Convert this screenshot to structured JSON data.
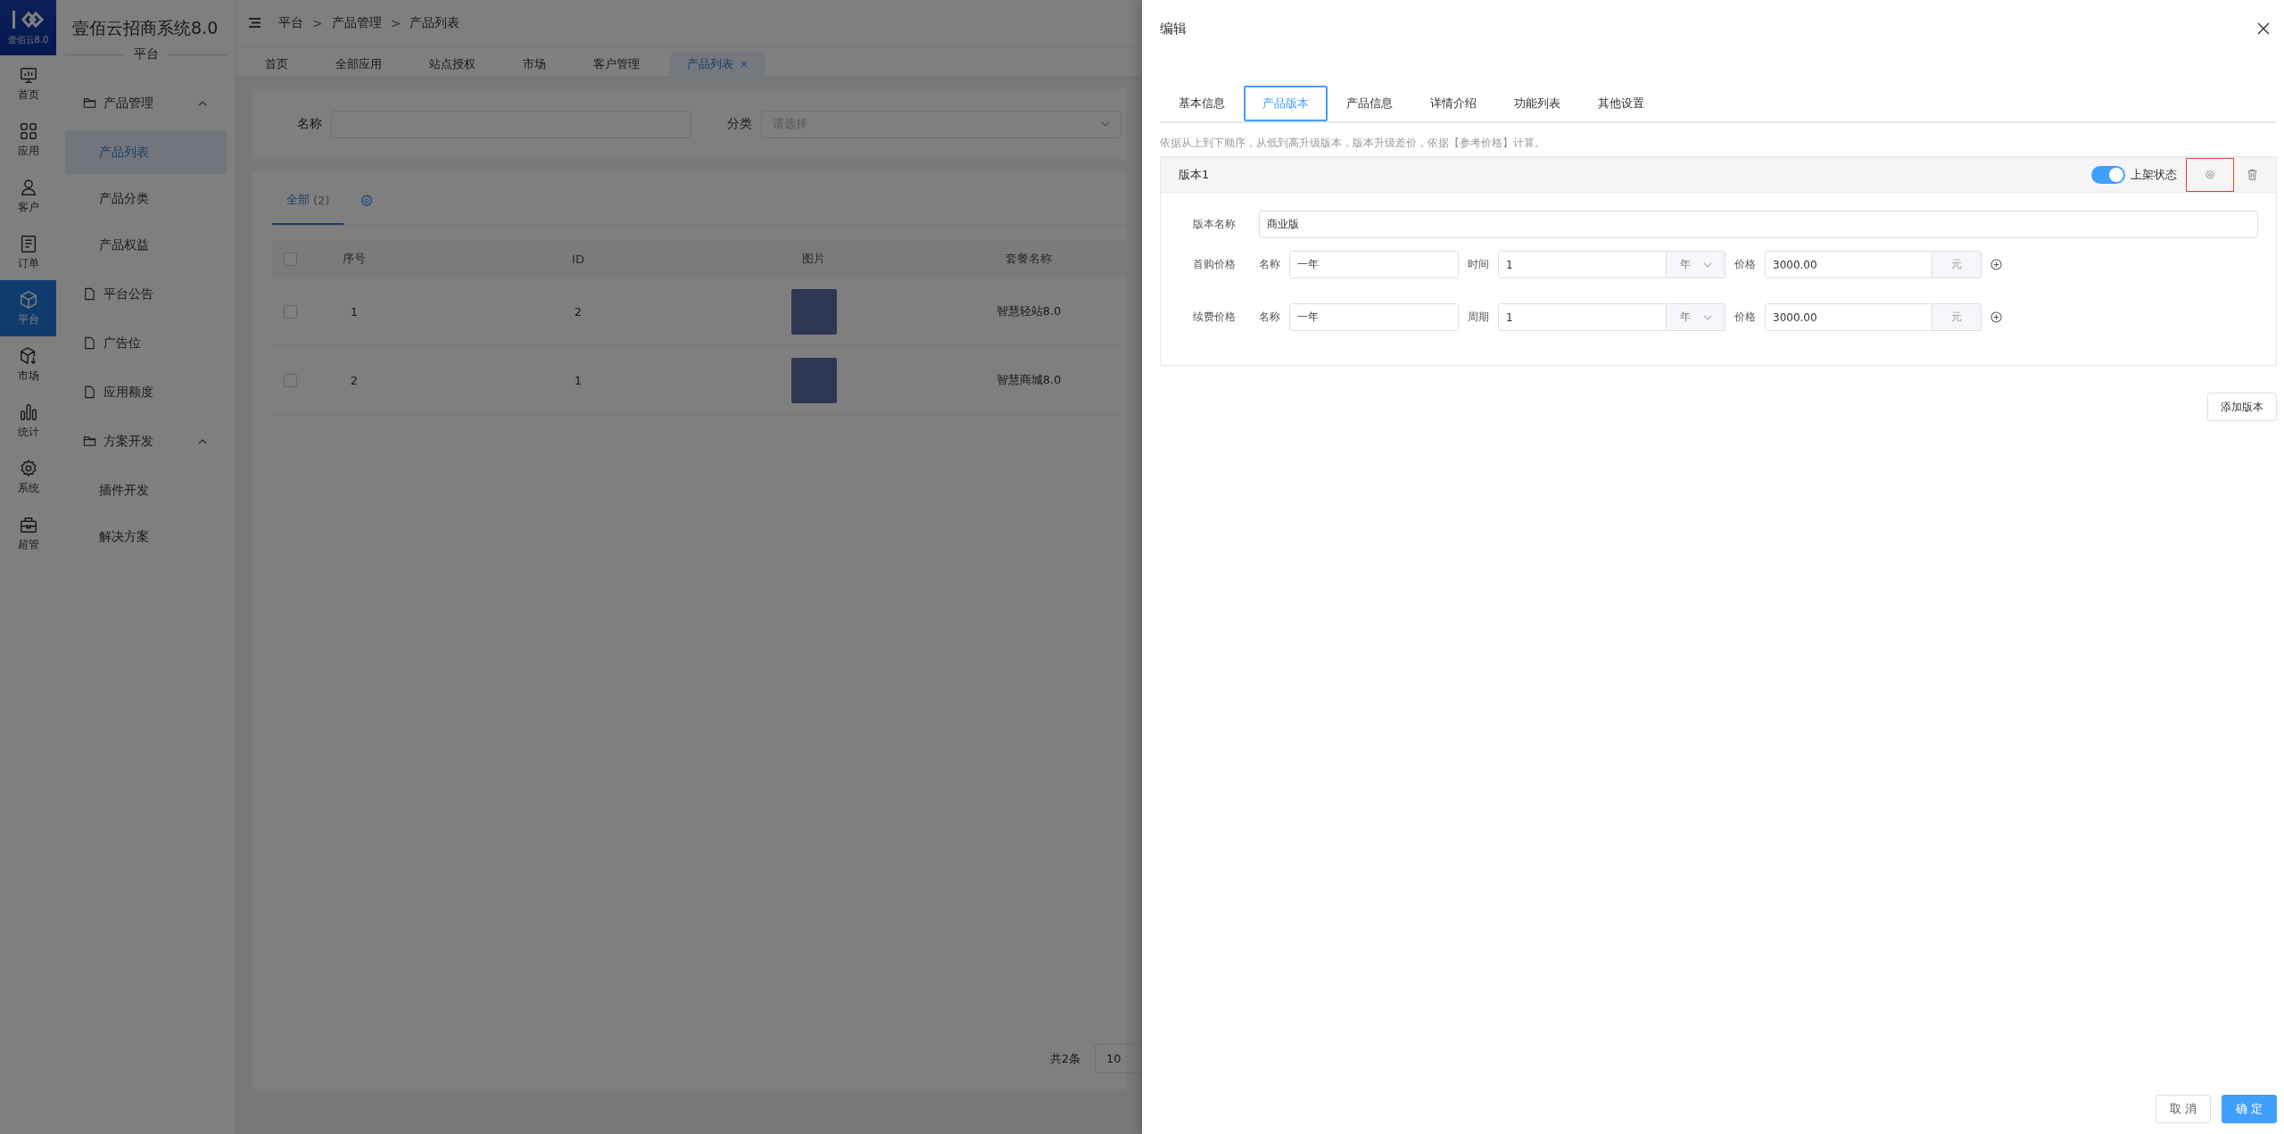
{
  "logo": {
    "caption": "壹佰云8.0"
  },
  "rail": [
    {
      "label": "首页",
      "selected": false
    },
    {
      "label": "应用",
      "selected": false
    },
    {
      "label": "客户",
      "selected": false
    },
    {
      "label": "订单",
      "selected": false
    },
    {
      "label": "平台",
      "selected": true
    },
    {
      "label": "市场",
      "selected": false
    },
    {
      "label": "统计",
      "selected": false
    },
    {
      "label": "系统",
      "selected": false
    },
    {
      "label": "超管",
      "selected": false
    }
  ],
  "app_title": "壹佰云招商系统8.0",
  "section_title": "平台",
  "menu": [
    {
      "kind": "group",
      "label": "产品管理",
      "expanded": true,
      "children": [
        {
          "label": "产品列表",
          "selected": true
        },
        {
          "label": "产品分类",
          "selected": false
        },
        {
          "label": "产品权益",
          "selected": false
        }
      ]
    },
    {
      "kind": "page",
      "label": "平台公告",
      "selected": false
    },
    {
      "kind": "page",
      "label": "广告位",
      "selected": false
    },
    {
      "kind": "page",
      "label": "应用额度",
      "selected": false
    },
    {
      "kind": "group",
      "label": "方案开发",
      "expanded": true,
      "children": [
        {
          "label": "插件开发",
          "selected": false
        },
        {
          "label": "解决方案",
          "selected": false
        }
      ]
    }
  ],
  "breadcrumb": {
    "separator": ">",
    "items": [
      "平台",
      "产品管理",
      "产品列表"
    ]
  },
  "page_tabs": [
    {
      "label": "首页",
      "selected": false
    },
    {
      "label": "全部应用",
      "selected": false
    },
    {
      "label": "站点授权",
      "selected": false
    },
    {
      "label": "市场",
      "selected": false
    },
    {
      "label": "客户管理",
      "selected": false
    },
    {
      "label": "产品列表",
      "selected": true
    }
  ],
  "filters": [
    {
      "kind": "text",
      "label": "名称"
    },
    {
      "kind": "select",
      "label": "分类",
      "placeholder": "请选择"
    }
  ],
  "list_tabs": [
    {
      "label": "全部",
      "count": "(2)",
      "selected": true
    }
  ],
  "table": {
    "columns": [
      "序号",
      "ID",
      "图片",
      "套餐名称"
    ],
    "all_checked": false,
    "rows": [
      {
        "checked": false,
        "cells": [
          "1",
          "2",
          "智慧轻站8.0"
        ]
      },
      {
        "checked": false,
        "cells": [
          "2",
          "1",
          "智慧商城8.0"
        ]
      }
    ]
  },
  "pagination": {
    "total": "共2条",
    "page_size": "10"
  },
  "drawer": {
    "title": "编辑",
    "tabs": [
      {
        "label": "基本信息",
        "selected": false
      },
      {
        "label": "产品版本",
        "selected": true
      },
      {
        "label": "产品信息",
        "selected": false
      },
      {
        "label": "详情介绍",
        "selected": false
      },
      {
        "label": "功能列表",
        "selected": false
      },
      {
        "label": "其他设置",
        "selected": false
      }
    ],
    "hint": "依据从上到下顺序，从低到高升级版本，版本升级差价，依据【参考价格】计算。",
    "versions": [
      {
        "title": "版本1",
        "status_label": "上架状态",
        "on": true,
        "settings_highlighted": true,
        "name_label": "版本名称",
        "name_value": "商业版",
        "prices": [
          {
            "label": "首购价格",
            "name_label": "名称",
            "name_value": "一年",
            "period_label": "时间",
            "period_value": "1",
            "unit": "年",
            "price_label": "价格",
            "price_value": "3000.00",
            "currency": "元"
          },
          {
            "label": "续费价格",
            "name_label": "名称",
            "name_value": "一年",
            "period_label": "周期",
            "period_value": "1",
            "unit": "年",
            "price_label": "价格",
            "price_value": "3000.00",
            "currency": "元"
          }
        ]
      }
    ],
    "add_button": "添加版本",
    "buttons": [
      {
        "kind": "cancel",
        "label": "取 消"
      },
      {
        "kind": "primary",
        "label": "确 定"
      }
    ]
  }
}
